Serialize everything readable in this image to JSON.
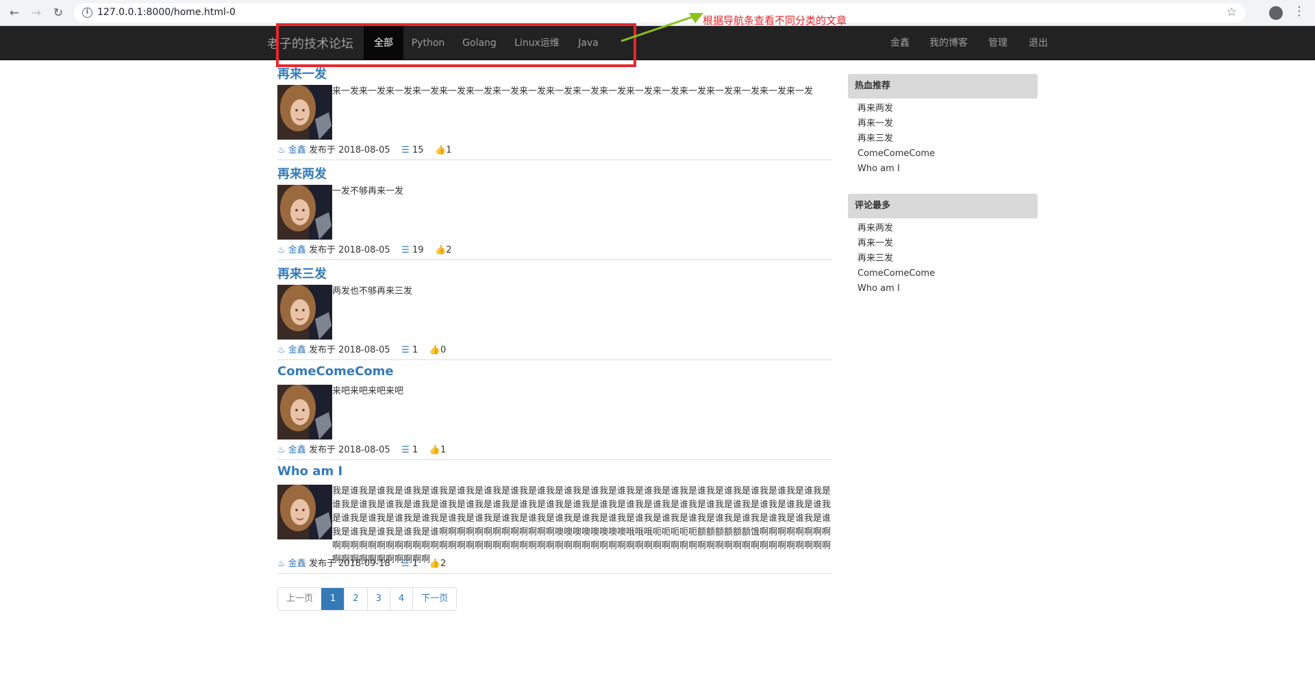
{
  "browser": {
    "url": "127.0.0.1:8000/home.html-0"
  },
  "navbar": {
    "brand": "老子的技术论坛",
    "categories": [
      "全部",
      "Python",
      "Golang",
      "Linux运维",
      "Java"
    ],
    "active_category": "全部",
    "right_links": [
      "金鑫",
      "我的博客",
      "管理",
      "退出"
    ]
  },
  "annotation": {
    "text": "根据导航条查看不同分类的文章",
    "color": "#e8262d"
  },
  "articles": [
    {
      "title": "再来一发",
      "body": "来一发来一发来一发来一发来一发来一发来一发来一发来一发来一发来一发来一发来一发来一发来一发来一发来一发来一发",
      "author": "金鑫",
      "published": "发布于 2018-08-05",
      "comments": "15",
      "likes": "1"
    },
    {
      "title": "再来两发",
      "body": "一发不够再来一发",
      "author": "金鑫",
      "published": "发布于 2018-08-05",
      "comments": "19",
      "likes": "2"
    },
    {
      "title": "再来三发",
      "body": "两发也不够再来三发",
      "author": "金鑫",
      "published": "发布于 2018-08-05",
      "comments": "1",
      "likes": "0"
    },
    {
      "title": "ComeComeCome",
      "body": "来吧来吧来吧来吧",
      "author": "金鑫",
      "published": "发布于 2018-08-05",
      "comments": "1",
      "likes": "1"
    },
    {
      "title": "Who am I",
      "body": "我是谁我是谁我是谁我是谁我是谁我是谁我是谁我是谁我是谁我是谁我是谁我是谁我是谁我是谁我是谁我是谁我是谁我是谁我是谁我是谁我是谁我是谁我是谁我是谁我是谁我是谁我是谁我是谁我是谁我是谁我是谁我是谁我是谁我是谁我是谁我是谁我是谁我是谁我是谁我是谁我是谁我是谁我是谁我是谁我是谁我是谁我是谁我是谁我是谁我是谁我是谁我是谁我是谁我是谁我是谁我是谁我是谁我是谁我是谁我是谁啊啊啊啊啊啊啊啊啊啊啊啊啊噢噢噢噢噢噢噢噢哦哦哦呃呃呃呃呃额额额额额额饿啊啊啊啊啊啊啊啊啊啊啊啊啊啊啊啊啊啊啊啊啊啊啊啊啊啊啊啊啊啊啊啊啊啊啊啊啊啊啊啊啊啊啊啊啊啊啊啊啊啊啊啊啊啊啊啊啊啊啊啊啊啊啊啊啊啊啊啊啊啊啊啊啊啊啊",
      "author": "金鑫",
      "published": "发布于 2018-09-18",
      "comments": "1",
      "likes": "2"
    }
  ],
  "sidebar": {
    "hot": {
      "heading": "热血推荐",
      "items": [
        "再来两发",
        "再来一发",
        "再来三发",
        "ComeComeCome",
        "Who am I"
      ]
    },
    "most_commented": {
      "heading": "评论最多",
      "items": [
        "再来两发",
        "再来一发",
        "再来三发",
        "ComeComeCome",
        "Who am I"
      ]
    }
  },
  "pagination": {
    "prev": "上一页",
    "pages": [
      "1",
      "2",
      "3",
      "4"
    ],
    "current": "1",
    "next": "下一页"
  }
}
